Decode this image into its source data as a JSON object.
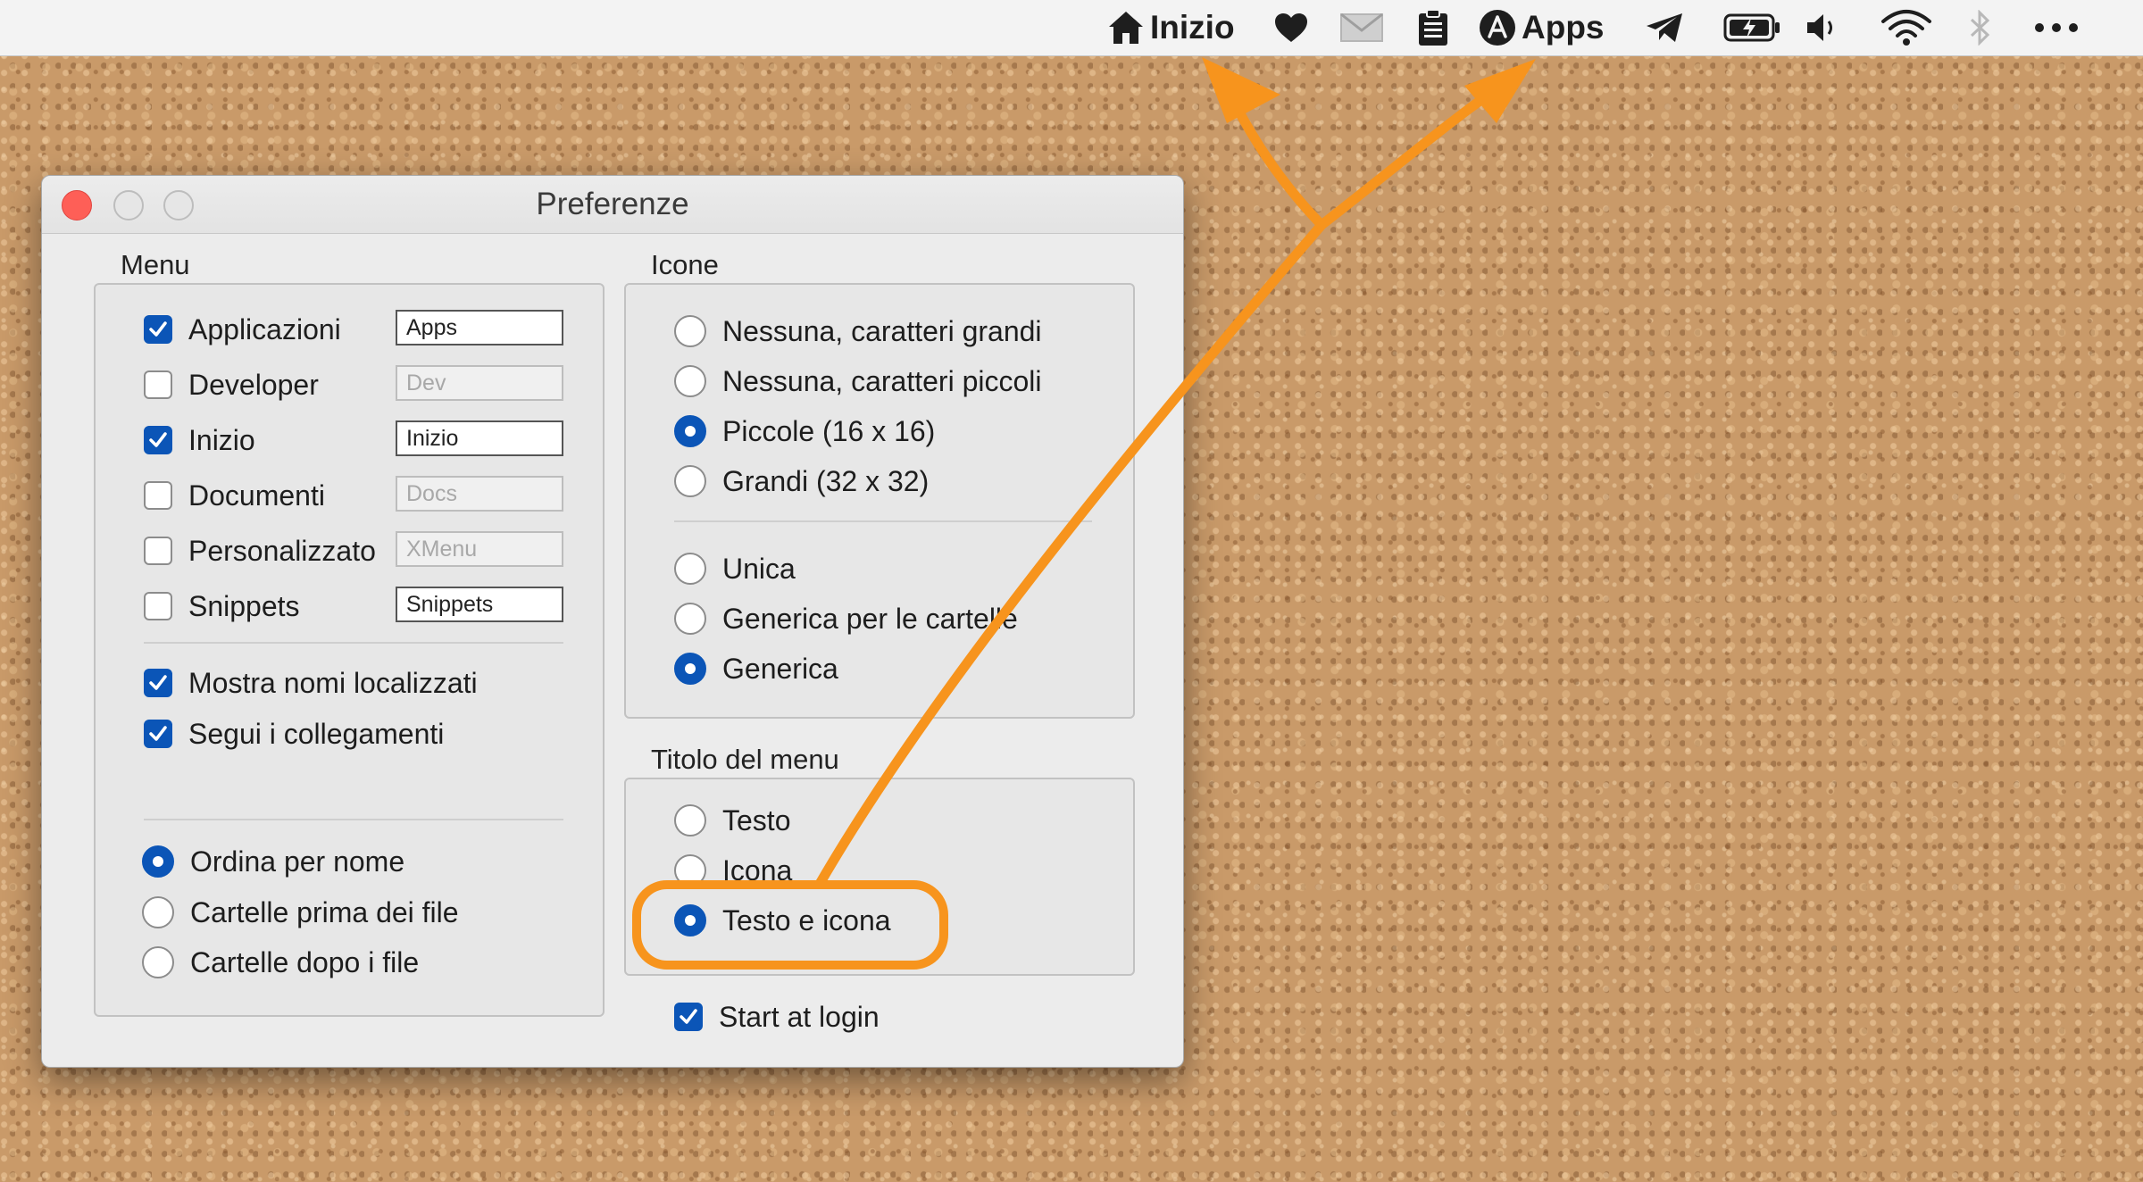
{
  "menubar": {
    "home_label": "Inizio",
    "apps_label": "Apps",
    "icons": [
      "house-icon",
      "heart-icon",
      "mail-icon",
      "clipboard-icon",
      "app-store-icon",
      "telegram-icon",
      "battery-charging-icon",
      "volume-icon",
      "wifi-icon",
      "bluetooth-icon",
      "more-icon"
    ]
  },
  "window": {
    "title": "Preferenze",
    "menu": {
      "label": "Menu",
      "items": [
        {
          "label": "Applicazioni",
          "checked": true,
          "field": "Apps",
          "enabled": true
        },
        {
          "label": "Developer",
          "checked": false,
          "field": "Dev",
          "enabled": false
        },
        {
          "label": "Inizio",
          "checked": true,
          "field": "Inizio",
          "enabled": true
        },
        {
          "label": "Documenti",
          "checked": false,
          "field": "Docs",
          "enabled": false
        },
        {
          "label": "Personalizzato",
          "checked": false,
          "field": "XMenu",
          "enabled": false
        },
        {
          "label": "Snippets",
          "checked": false,
          "field": "Snippets",
          "enabled": true
        }
      ],
      "options": [
        {
          "label": "Mostra nomi localizzati",
          "checked": true
        },
        {
          "label": "Segui i collegamenti",
          "checked": true
        }
      ],
      "sort": [
        {
          "label": "Ordina per nome",
          "selected": true
        },
        {
          "label": "Cartelle prima dei file",
          "selected": false
        },
        {
          "label": "Cartelle dopo i file",
          "selected": false
        }
      ]
    },
    "icone": {
      "label": "Icone",
      "size": [
        {
          "label": "Nessuna, caratteri grandi",
          "selected": false
        },
        {
          "label": "Nessuna, caratteri piccoli",
          "selected": false
        },
        {
          "label": "Piccole (16 x 16)",
          "selected": true
        },
        {
          "label": "Grandi (32 x 32)",
          "selected": false
        }
      ],
      "type": [
        {
          "label": "Unica",
          "selected": false
        },
        {
          "label": "Generica per le cartelle",
          "selected": false
        },
        {
          "label": "Generica",
          "selected": true
        }
      ]
    },
    "titolo": {
      "label": "Titolo del menu",
      "options": [
        {
          "label": "Testo",
          "selected": false
        },
        {
          "label": "Icona",
          "selected": false
        },
        {
          "label": "Testo e icona",
          "selected": true
        }
      ]
    },
    "start_at_login": {
      "label": "Start at login",
      "checked": true
    }
  },
  "colors": {
    "accent": "#0b55b7",
    "annotation": "#f7941d",
    "close": "#fe5f57",
    "background": "#c99a69"
  }
}
